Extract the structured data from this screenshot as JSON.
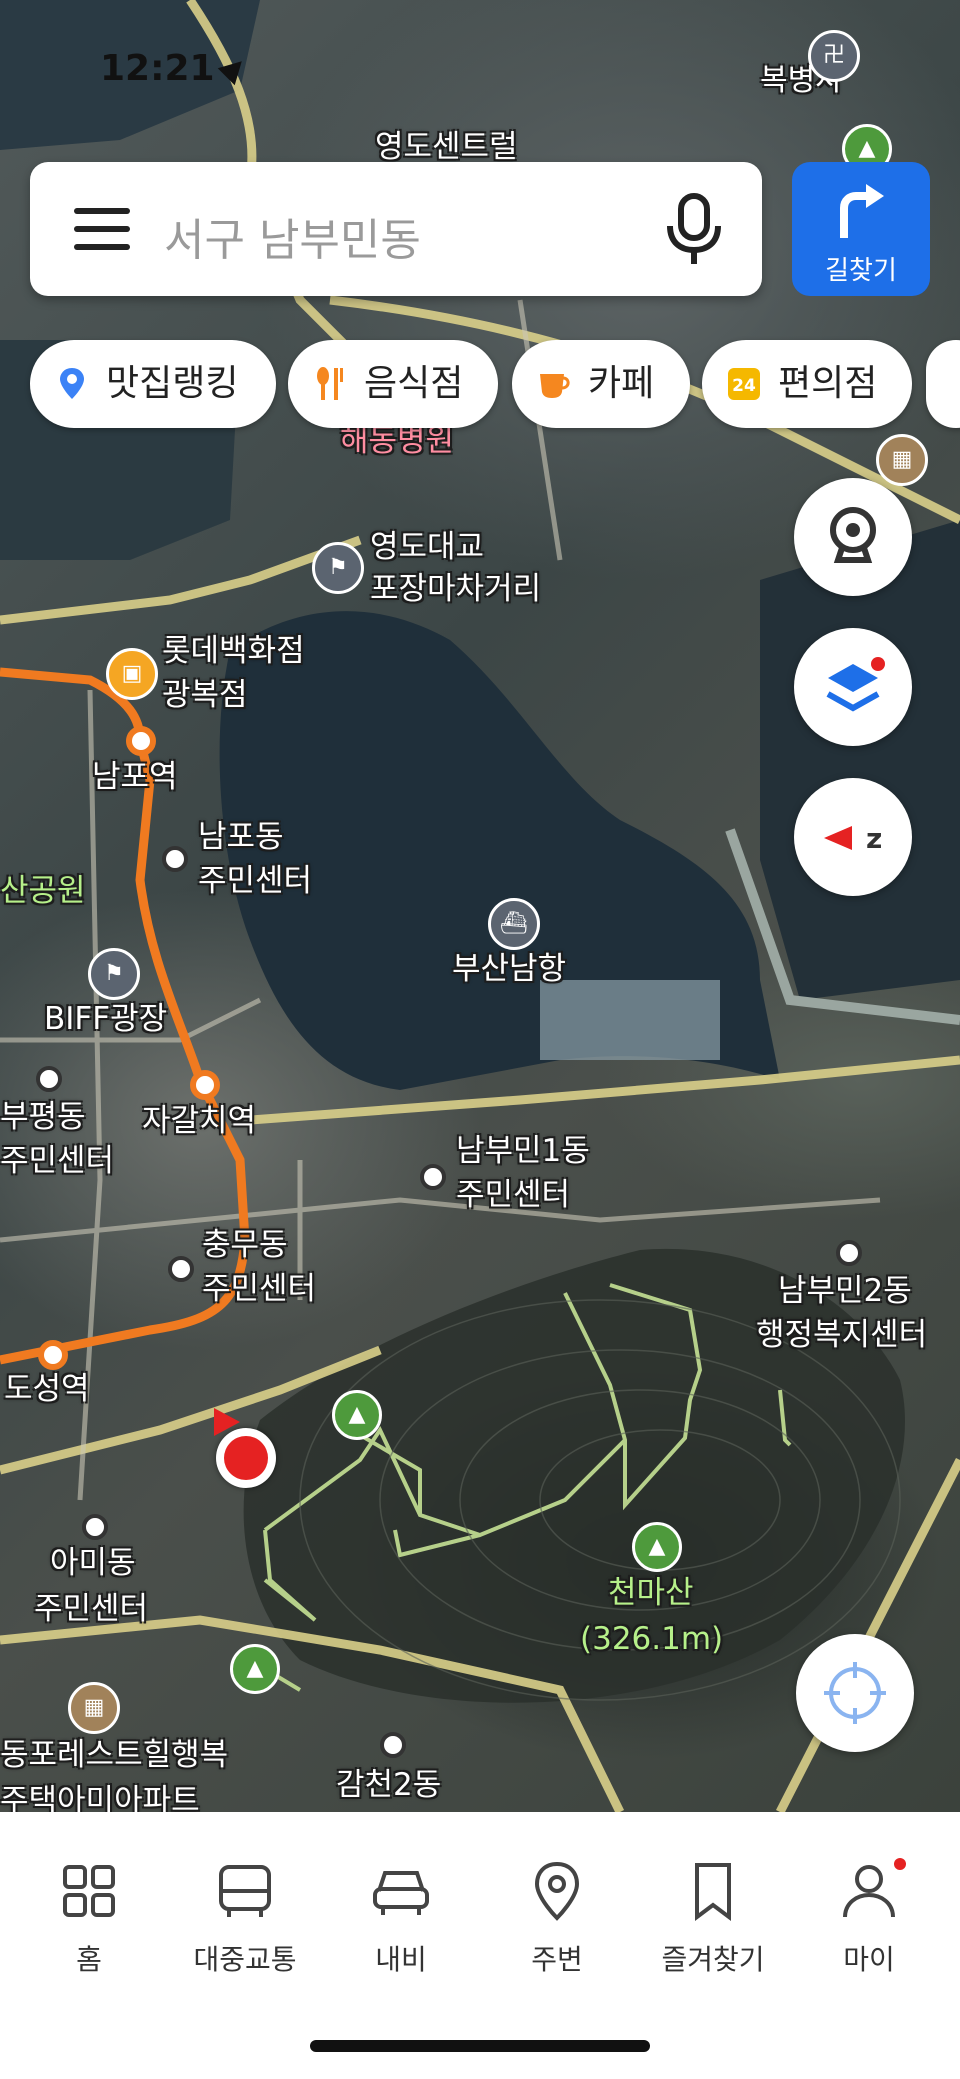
{
  "status": {
    "time": "12:21"
  },
  "search": {
    "placeholder": "서구 남부민동",
    "route_label": "길찾기"
  },
  "chips": [
    {
      "label": "맛집랭킹",
      "icon": "ranking-pin-icon",
      "color": "#3b82f6"
    },
    {
      "label": "음식점",
      "icon": "utensils-icon",
      "color": "#f5871f"
    },
    {
      "label": "카페",
      "icon": "coffee-cup-icon",
      "color": "#f5871f"
    },
    {
      "label": "편의점",
      "icon": "24h-store-icon",
      "color": "#f5b800"
    }
  ],
  "map": {
    "labels": {
      "youngdo_central": "영도센트럴",
      "haedong": "해동병원",
      "youngdo_bridge_1": "영도대교",
      "youngdo_bridge_2": "포장마차거리",
      "lotte_1": "롯데백화점",
      "lotte_2": "광복점",
      "nampo_station": "남포역",
      "nampo_center_1": "남포동",
      "nampo_center_2": "주민센터",
      "busan_port": "부산남항",
      "biff": "BIFF광장",
      "bupyeong_1": "부평동",
      "bupyeong_2": "주민센터",
      "jagalchi": "자갈치역",
      "nambumin1_1": "남부민1동",
      "nambumin1_2": "주민센터",
      "chungmu_1": "충무동",
      "chungmu_2": "주민센터",
      "nambumin2_1": "남부민2동",
      "nambumin2_2": "행정복지센터",
      "toseong": "도성역",
      "amidong_1": "아미동",
      "amidong_2": "주민센터",
      "cheonmasan": "천마산",
      "cheonmasan_height": "(326.1m)",
      "forest_1": "동포레스트힐행복",
      "forest_2": "주택아미아파트",
      "gamcheon": "감천2동",
      "park": "산공원",
      "bokbyeongsa": "복병사"
    }
  },
  "nav": [
    {
      "label": "홈",
      "icon": "grid-home-icon"
    },
    {
      "label": "대중교통",
      "icon": "bus-icon"
    },
    {
      "label": "내비",
      "icon": "car-icon"
    },
    {
      "label": "주변",
      "icon": "location-pin-icon"
    },
    {
      "label": "즐겨찾기",
      "icon": "bookmark-icon"
    },
    {
      "label": "마이",
      "icon": "user-icon"
    }
  ],
  "colors": {
    "accent": "#1e6fe8",
    "subway": "#f07a20",
    "trail": "#b6d08a",
    "location": "#e52222"
  }
}
